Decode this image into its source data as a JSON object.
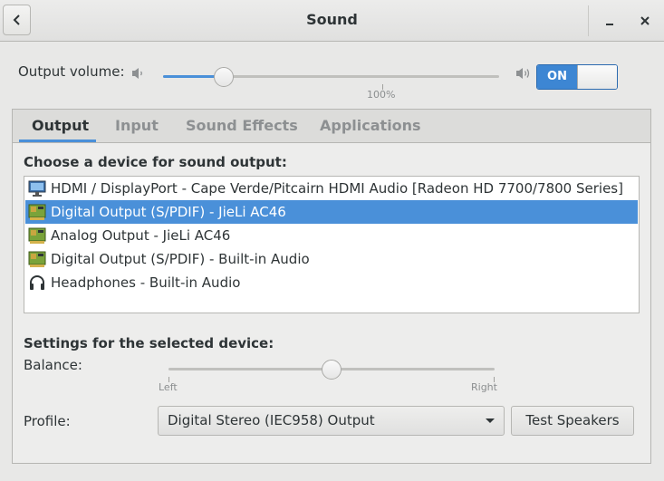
{
  "window": {
    "title": "Sound",
    "back_icon": "chevron-left-icon",
    "minimize_icon": "minimize-icon",
    "close_icon": "close-icon"
  },
  "output_volume": {
    "label": "Output volume:",
    "level_percent": 100,
    "slider_fraction": 0.18,
    "tick_label": "100%",
    "low_icon": "speaker-low-icon",
    "high_icon": "speaker-high-icon",
    "switch_label": "ON",
    "switch_on": true
  },
  "tabs": [
    {
      "label": "Output",
      "active": true
    },
    {
      "label": "Input",
      "active": false
    },
    {
      "label": "Sound Effects",
      "active": false
    },
    {
      "label": "Applications",
      "active": false
    }
  ],
  "device_section": {
    "heading": "Choose a device for sound output:",
    "devices": [
      {
        "label": "HDMI / DisplayPort - Cape Verde/Pitcairn HDMI Audio [Radeon HD 7700/7800 Series]",
        "icon": "monitor-icon",
        "selected": false
      },
      {
        "label": "Digital Output (S/PDIF) - JieLi AC46",
        "icon": "sound-card-icon",
        "selected": true
      },
      {
        "label": "Analog Output - JieLi AC46",
        "icon": "sound-card-icon",
        "selected": false
      },
      {
        "label": "Digital Output (S/PDIF) - Built-in Audio",
        "icon": "sound-card-icon",
        "selected": false
      },
      {
        "label": "Headphones - Built-in Audio",
        "icon": "headphones-icon",
        "selected": false
      }
    ]
  },
  "settings": {
    "heading": "Settings for the selected device:",
    "balance_label": "Balance:",
    "balance_fraction": 0.5,
    "balance_left": "Left",
    "balance_right": "Right",
    "profile_label": "Profile:",
    "profile_value": "Digital Stereo (IEC958) Output",
    "test_button": "Test Speakers"
  },
  "colors": {
    "accent": "#4a90d9",
    "background": "#e8e8e7"
  }
}
